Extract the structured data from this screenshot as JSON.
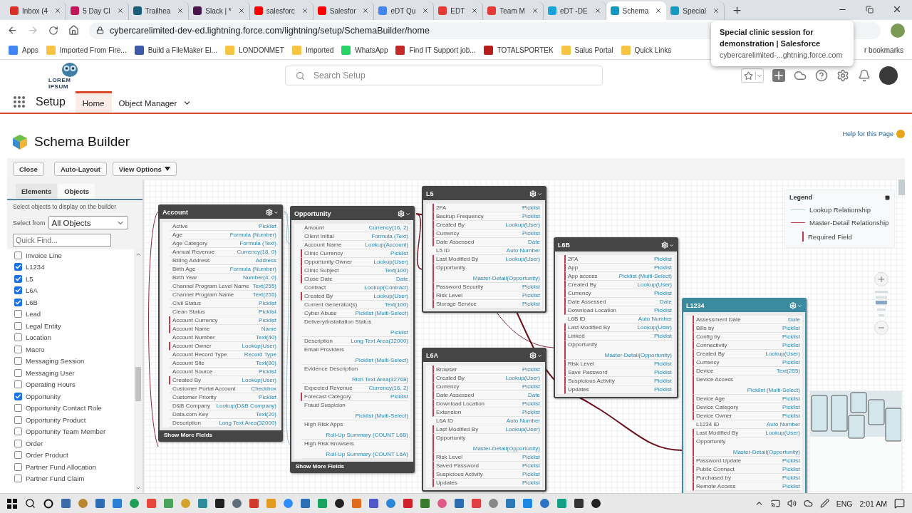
{
  "browser": {
    "tabs": [
      {
        "title": "Inbox (4",
        "selected": false,
        "color": "#d93025"
      },
      {
        "title": "5 Day Cl",
        "selected": false,
        "color": "#c2185b"
      },
      {
        "title": "Trailhea",
        "selected": false,
        "color": "#1b5e7a"
      },
      {
        "title": "Slack | *",
        "selected": false,
        "color": "#4a154b"
      },
      {
        "title": "salesforc",
        "selected": false,
        "color": "#ff0000"
      },
      {
        "title": "Salesfor",
        "selected": false,
        "color": "#ff0000"
      },
      {
        "title": "eDT Qu",
        "selected": false,
        "color": "#4285f4"
      },
      {
        "title": "EDT",
        "selected": false,
        "color": "#e53935"
      },
      {
        "title": "Team M",
        "selected": false,
        "color": "#e53935"
      },
      {
        "title": "eDT -DE",
        "selected": false,
        "color": "#1aa3d9"
      },
      {
        "title": "Schema",
        "selected": true,
        "color": "#1798c1"
      },
      {
        "title": "Special",
        "selected": false,
        "color": "#1798c1"
      }
    ],
    "address": "cybercarelimited-dev-ed.lightning.force.com/lightning/setup/SchemaBuilder/home",
    "bookmarks": [
      {
        "label": "Apps",
        "color": "#4285f4"
      },
      {
        "label": "Imported From Fire...",
        "color": "#f6c342"
      },
      {
        "label": "Build a FileMaker El...",
        "color": "#3b5ba9"
      },
      {
        "label": "LONDONMET",
        "color": "#f6c342"
      },
      {
        "label": "Imported",
        "color": "#f6c342"
      },
      {
        "label": "WhatsApp",
        "color": "#25d366"
      },
      {
        "label": "Find IT Support job...",
        "color": "#c62828"
      },
      {
        "label": "TOTALSPORTEK",
        "color": "#b71c1c"
      },
      {
        "label": "Salus Portal",
        "color": "#f6c342"
      },
      {
        "label": "Quick Links",
        "color": "#f6c342"
      },
      {
        "label": "r bookmarks"
      }
    ],
    "tooltip": {
      "title": "Special clinic session for demonstration | Salesforce",
      "url": "cybercarelimited-...ghtning.force.com"
    }
  },
  "header": {
    "logo_text": "LOREM IPSUM",
    "search": {
      "placeholder": "Search Setup"
    }
  },
  "nav": {
    "app": "Setup",
    "tabs": [
      {
        "label": "Home",
        "selected": true
      },
      {
        "label": "Object Manager",
        "selected": false
      }
    ]
  },
  "page": {
    "title": "Schema Builder",
    "help_link": "Help for this Page",
    "buttons": [
      "Close",
      "Auto-Layout",
      "View Options"
    ]
  },
  "sidebar": {
    "tabs": [
      {
        "label": "Elements",
        "selected": false
      },
      {
        "label": "Objects",
        "selected": true
      }
    ],
    "hint": "Select objects to display on the builder",
    "select_label": "Select from",
    "select_value": "All Objects",
    "quick_find": {
      "placeholder": "Quick Find..."
    },
    "objects": [
      {
        "label": "Invoice Line",
        "checked": false
      },
      {
        "label": "L1234",
        "checked": true
      },
      {
        "label": "L5",
        "checked": true
      },
      {
        "label": "L6A",
        "checked": true
      },
      {
        "label": "L6B",
        "checked": true
      },
      {
        "label": "Lead",
        "checked": false
      },
      {
        "label": "Legal Entity",
        "checked": false
      },
      {
        "label": "Location",
        "checked": false
      },
      {
        "label": "Macro",
        "checked": false
      },
      {
        "label": "Messaging Session",
        "checked": false
      },
      {
        "label": "Messaging User",
        "checked": false
      },
      {
        "label": "Operating Hours",
        "checked": false
      },
      {
        "label": "Opportunity",
        "checked": true
      },
      {
        "label": "Opportunity Contact Role",
        "checked": false
      },
      {
        "label": "Opportunity Product",
        "checked": false
      },
      {
        "label": "Opportunity Team Member",
        "checked": false
      },
      {
        "label": "Order",
        "checked": false
      },
      {
        "label": "Order Product",
        "checked": false
      },
      {
        "label": "Partner Fund Allocation",
        "checked": false
      },
      {
        "label": "Partner Fund Claim",
        "checked": false
      }
    ]
  },
  "canvas": {
    "objects": [
      {
        "name": "Account",
        "selected": false,
        "show_more": "Show More Fields",
        "fields": [
          {
            "name": "Active",
            "type": "Picklist",
            "required": false,
            "stacked": false
          },
          {
            "name": "Age",
            "type": "Formula (Number)",
            "required": false,
            "stacked": false
          },
          {
            "name": "Age Category",
            "type": "Formula (Text)",
            "required": false,
            "stacked": false
          },
          {
            "name": "Annual Revenue",
            "type": "Currency(18, 0)",
            "required": false,
            "stacked": false
          },
          {
            "name": "Billing Address",
            "type": "Address",
            "required": false,
            "stacked": false
          },
          {
            "name": "Birth Age",
            "type": "Formula (Number)",
            "required": false,
            "stacked": false
          },
          {
            "name": "Birth Year",
            "type": "Number(4, 0)",
            "required": false,
            "stacked": false
          },
          {
            "name": "Channel Program Level Name",
            "type": "Text(255)",
            "required": false,
            "stacked": false
          },
          {
            "name": "Channel Program Name",
            "type": "Text(255)",
            "required": false,
            "stacked": false
          },
          {
            "name": "Civil Status",
            "type": "Picklist",
            "required": false,
            "stacked": false
          },
          {
            "name": "Clean Status",
            "type": "Picklist",
            "required": false,
            "stacked": false
          },
          {
            "name": "Account Currency",
            "type": "Picklist",
            "required": true,
            "stacked": false
          },
          {
            "name": "Account Name",
            "type": "Name",
            "required": true,
            "stacked": false
          },
          {
            "name": "Account Number",
            "type": "Text(40)",
            "required": false,
            "stacked": false
          },
          {
            "name": "Account Owner",
            "type": "Lookup(User)",
            "required": true,
            "stacked": false
          },
          {
            "name": "Account Record Type",
            "type": "Record Type",
            "required": false,
            "stacked": false
          },
          {
            "name": "Account Site",
            "type": "Text(80)",
            "required": false,
            "stacked": false
          },
          {
            "name": "Account Source",
            "type": "Picklist",
            "required": false,
            "stacked": false
          },
          {
            "name": "Created By",
            "type": "Lookup(User)",
            "required": true,
            "stacked": false
          },
          {
            "name": "Customer Portal Account",
            "type": "Checkbox",
            "required": false,
            "stacked": false
          },
          {
            "name": "Customer Priority",
            "type": "Picklist",
            "required": false,
            "stacked": false
          },
          {
            "name": "D&B Company",
            "type": "Lookup(D&B Company)",
            "required": false,
            "stacked": false
          },
          {
            "name": "Data.com Key",
            "type": "Text(20)",
            "required": false,
            "stacked": false
          },
          {
            "name": "Description",
            "type": "Long Text Area(32000)",
            "required": false,
            "stacked": false
          }
        ]
      },
      {
        "name": "Opportunity",
        "selected": false,
        "show_more": "Show More Fields",
        "fields": [
          {
            "name": "Amount",
            "type": "Currency(16, 2)",
            "required": false,
            "stacked": false
          },
          {
            "name": "Client Initial",
            "type": "Formula (Text)",
            "required": false,
            "stacked": false
          },
          {
            "name": "Account Name",
            "type": "Lookup(Account)",
            "required": false,
            "stacked": false
          },
          {
            "name": "Clinic Currency",
            "type": "Picklist",
            "required": true,
            "stacked": false
          },
          {
            "name": "Opportunity Owner",
            "type": "Lookup(User)",
            "required": true,
            "stacked": false
          },
          {
            "name": "Clinic Subject",
            "type": "Text(100)",
            "required": true,
            "stacked": false
          },
          {
            "name": "Close Date",
            "type": "Date",
            "required": true,
            "stacked": false
          },
          {
            "name": "Contract",
            "type": "Lookup(Contract)",
            "required": false,
            "stacked": false
          },
          {
            "name": "Created By",
            "type": "Lookup(User)",
            "required": true,
            "stacked": false
          },
          {
            "name": "Current Generator(s)",
            "type": "Text(100)",
            "required": false,
            "stacked": false
          },
          {
            "name": "Cyber Abuse",
            "type": "Picklist (Multi-Select)",
            "required": false,
            "stacked": false
          },
          {
            "name": "Delivery/Installation Status",
            "type": "Picklist",
            "required": false,
            "stacked": true
          },
          {
            "name": "Description",
            "type": "Long Text Area(32000)",
            "required": false,
            "stacked": false
          },
          {
            "name": "Email Providers",
            "type": "Picklist (Multi-Select)",
            "required": false,
            "stacked": true
          },
          {
            "name": "Evidence Description",
            "type": "Rich Text Area(32768)",
            "required": false,
            "stacked": true
          },
          {
            "name": "Expected Revenue",
            "type": "Currency(16, 2)",
            "required": false,
            "stacked": false
          },
          {
            "name": "Forecast Category",
            "type": "Picklist",
            "required": true,
            "stacked": false
          },
          {
            "name": "Fraud Suspicion",
            "type": "Picklist (Multi-Select)",
            "required": false,
            "stacked": true
          },
          {
            "name": "High Risk Apps",
            "type": "Roll-Up Summary (COUNT L6B)",
            "required": false,
            "stacked": true
          },
          {
            "name": "High Risk Browsers",
            "type": "Roll-Up Summary (COUNT L6A)",
            "required": false,
            "stacked": true
          }
        ]
      },
      {
        "name": "L5",
        "selected": false,
        "fields": [
          {
            "name": "2FA",
            "type": "Picklist",
            "required": true,
            "stacked": false
          },
          {
            "name": "Backup Frequency",
            "type": "Picklist",
            "required": true,
            "stacked": false
          },
          {
            "name": "Created By",
            "type": "Lookup(User)",
            "required": true,
            "stacked": false
          },
          {
            "name": "Currency",
            "type": "Picklist",
            "required": true,
            "stacked": false
          },
          {
            "name": "Date Assessed",
            "type": "Date",
            "required": true,
            "stacked": false
          },
          {
            "name": "L5 ID",
            "type": "Auto Number",
            "required": false,
            "stacked": false
          },
          {
            "name": "Last Modified By",
            "type": "Lookup(User)",
            "required": true,
            "stacked": false
          },
          {
            "name": "Opportunity",
            "type": "Master-Detail(Opportunity)",
            "required": true,
            "stacked": true
          },
          {
            "name": "Password Security",
            "type": "Picklist",
            "required": true,
            "stacked": false
          },
          {
            "name": "Risk Level",
            "type": "Picklist",
            "required": true,
            "stacked": false
          },
          {
            "name": "Storage Service",
            "type": "Picklist",
            "required": true,
            "stacked": false
          }
        ]
      },
      {
        "name": "L6B",
        "selected": false,
        "fields": [
          {
            "name": "2FA",
            "type": "Picklist",
            "required": true,
            "stacked": false
          },
          {
            "name": "App",
            "type": "Picklist",
            "required": true,
            "stacked": false
          },
          {
            "name": "App access",
            "type": "Picklist (Multi-Select)",
            "required": true,
            "stacked": false
          },
          {
            "name": "Created By",
            "type": "Lookup(User)",
            "required": true,
            "stacked": false
          },
          {
            "name": "Currency",
            "type": "Picklist",
            "required": true,
            "stacked": false
          },
          {
            "name": "Date Assessed",
            "type": "Date",
            "required": true,
            "stacked": false
          },
          {
            "name": "Download Location",
            "type": "Picklist",
            "required": true,
            "stacked": false
          },
          {
            "name": "L6B ID",
            "type": "Auto Number",
            "required": false,
            "stacked": false
          },
          {
            "name": "Last Modified By",
            "type": "Lookup(User)",
            "required": true,
            "stacked": false
          },
          {
            "name": "Linked",
            "type": "Picklist",
            "required": true,
            "stacked": false
          },
          {
            "name": "Opportunity",
            "type": "Master-Detail(Opportunity)",
            "required": true,
            "stacked": true
          },
          {
            "name": "Risk Level",
            "type": "Picklist",
            "required": true,
            "stacked": false
          },
          {
            "name": "Save Password",
            "type": "Picklist",
            "required": true,
            "stacked": false
          },
          {
            "name": "Suspicious Activity",
            "type": "Picklist",
            "required": true,
            "stacked": false
          },
          {
            "name": "Updates",
            "type": "Picklist",
            "required": true,
            "stacked": false
          }
        ]
      },
      {
        "name": "L6A",
        "selected": false,
        "fields": [
          {
            "name": "Browser",
            "type": "Picklist",
            "required": true,
            "stacked": false
          },
          {
            "name": "Created By",
            "type": "Lookup(User)",
            "required": true,
            "stacked": false
          },
          {
            "name": "Currency",
            "type": "Picklist",
            "required": true,
            "stacked": false
          },
          {
            "name": "Date Assessed",
            "type": "Date",
            "required": true,
            "stacked": false
          },
          {
            "name": "Download Location",
            "type": "Picklist",
            "required": true,
            "stacked": false
          },
          {
            "name": "Extension",
            "type": "Picklist",
            "required": true,
            "stacked": false
          },
          {
            "name": "L6A ID",
            "type": "Auto Number",
            "required": false,
            "stacked": false
          },
          {
            "name": "Last Modified By",
            "type": "Lookup(User)",
            "required": true,
            "stacked": false
          },
          {
            "name": "Opportunity",
            "type": "Master-Detail(Opportunity)",
            "required": true,
            "stacked": true
          },
          {
            "name": "Risk Level",
            "type": "Picklist",
            "required": true,
            "stacked": false
          },
          {
            "name": "Saved Password",
            "type": "Picklist",
            "required": true,
            "stacked": false
          },
          {
            "name": "Suspicious Activity",
            "type": "Picklist",
            "required": true,
            "stacked": false
          },
          {
            "name": "Updates",
            "type": "Picklist",
            "required": true,
            "stacked": false
          }
        ]
      },
      {
        "name": "L1234",
        "selected": true,
        "fields": [
          {
            "name": "Assessment Date",
            "type": "Date",
            "required": true,
            "stacked": false
          },
          {
            "name": "Bills by",
            "type": "Picklist",
            "required": true,
            "stacked": false
          },
          {
            "name": "Config by",
            "type": "Picklist",
            "required": true,
            "stacked": false
          },
          {
            "name": "Connectivity",
            "type": "Picklist",
            "required": true,
            "stacked": false
          },
          {
            "name": "Created By",
            "type": "Lookup(User)",
            "required": true,
            "stacked": false
          },
          {
            "name": "Currency",
            "type": "Picklist",
            "required": true,
            "stacked": false
          },
          {
            "name": "Device",
            "type": "Text(255)",
            "required": true,
            "stacked": false
          },
          {
            "name": "Device Access",
            "type": "Picklist (Multi-Select)",
            "required": true,
            "stacked": true
          },
          {
            "name": "Device Age",
            "type": "Picklist",
            "required": true,
            "stacked": false
          },
          {
            "name": "Device Category",
            "type": "Picklist",
            "required": true,
            "stacked": false
          },
          {
            "name": "Device Owner",
            "type": "Picklist",
            "required": true,
            "stacked": false
          },
          {
            "name": "L1234 ID",
            "type": "Auto Number",
            "required": false,
            "stacked": false
          },
          {
            "name": "Last Modified By",
            "type": "Lookup(User)",
            "required": true,
            "stacked": false
          },
          {
            "name": "Opportunity",
            "type": "Master-Detail(Opportunity)",
            "required": true,
            "stacked": true
          },
          {
            "name": "Password Update",
            "type": "Picklist",
            "required": true,
            "stacked": false
          },
          {
            "name": "Public Connect",
            "type": "Picklist",
            "required": true,
            "stacked": false
          },
          {
            "name": "Purchased by",
            "type": "Picklist",
            "required": true,
            "stacked": false
          },
          {
            "name": "Remote Access",
            "type": "Picklist",
            "required": true,
            "stacked": false
          }
        ]
      }
    ],
    "legend": {
      "title": "Legend",
      "items": [
        {
          "label": "Lookup Relationship",
          "kind": "lookup"
        },
        {
          "label": "Master-Detail Relationship",
          "kind": "master"
        },
        {
          "label": "Required Field",
          "kind": "required"
        }
      ]
    }
  },
  "taskbar": {
    "language": "ENG",
    "time": "2:01 AM"
  }
}
